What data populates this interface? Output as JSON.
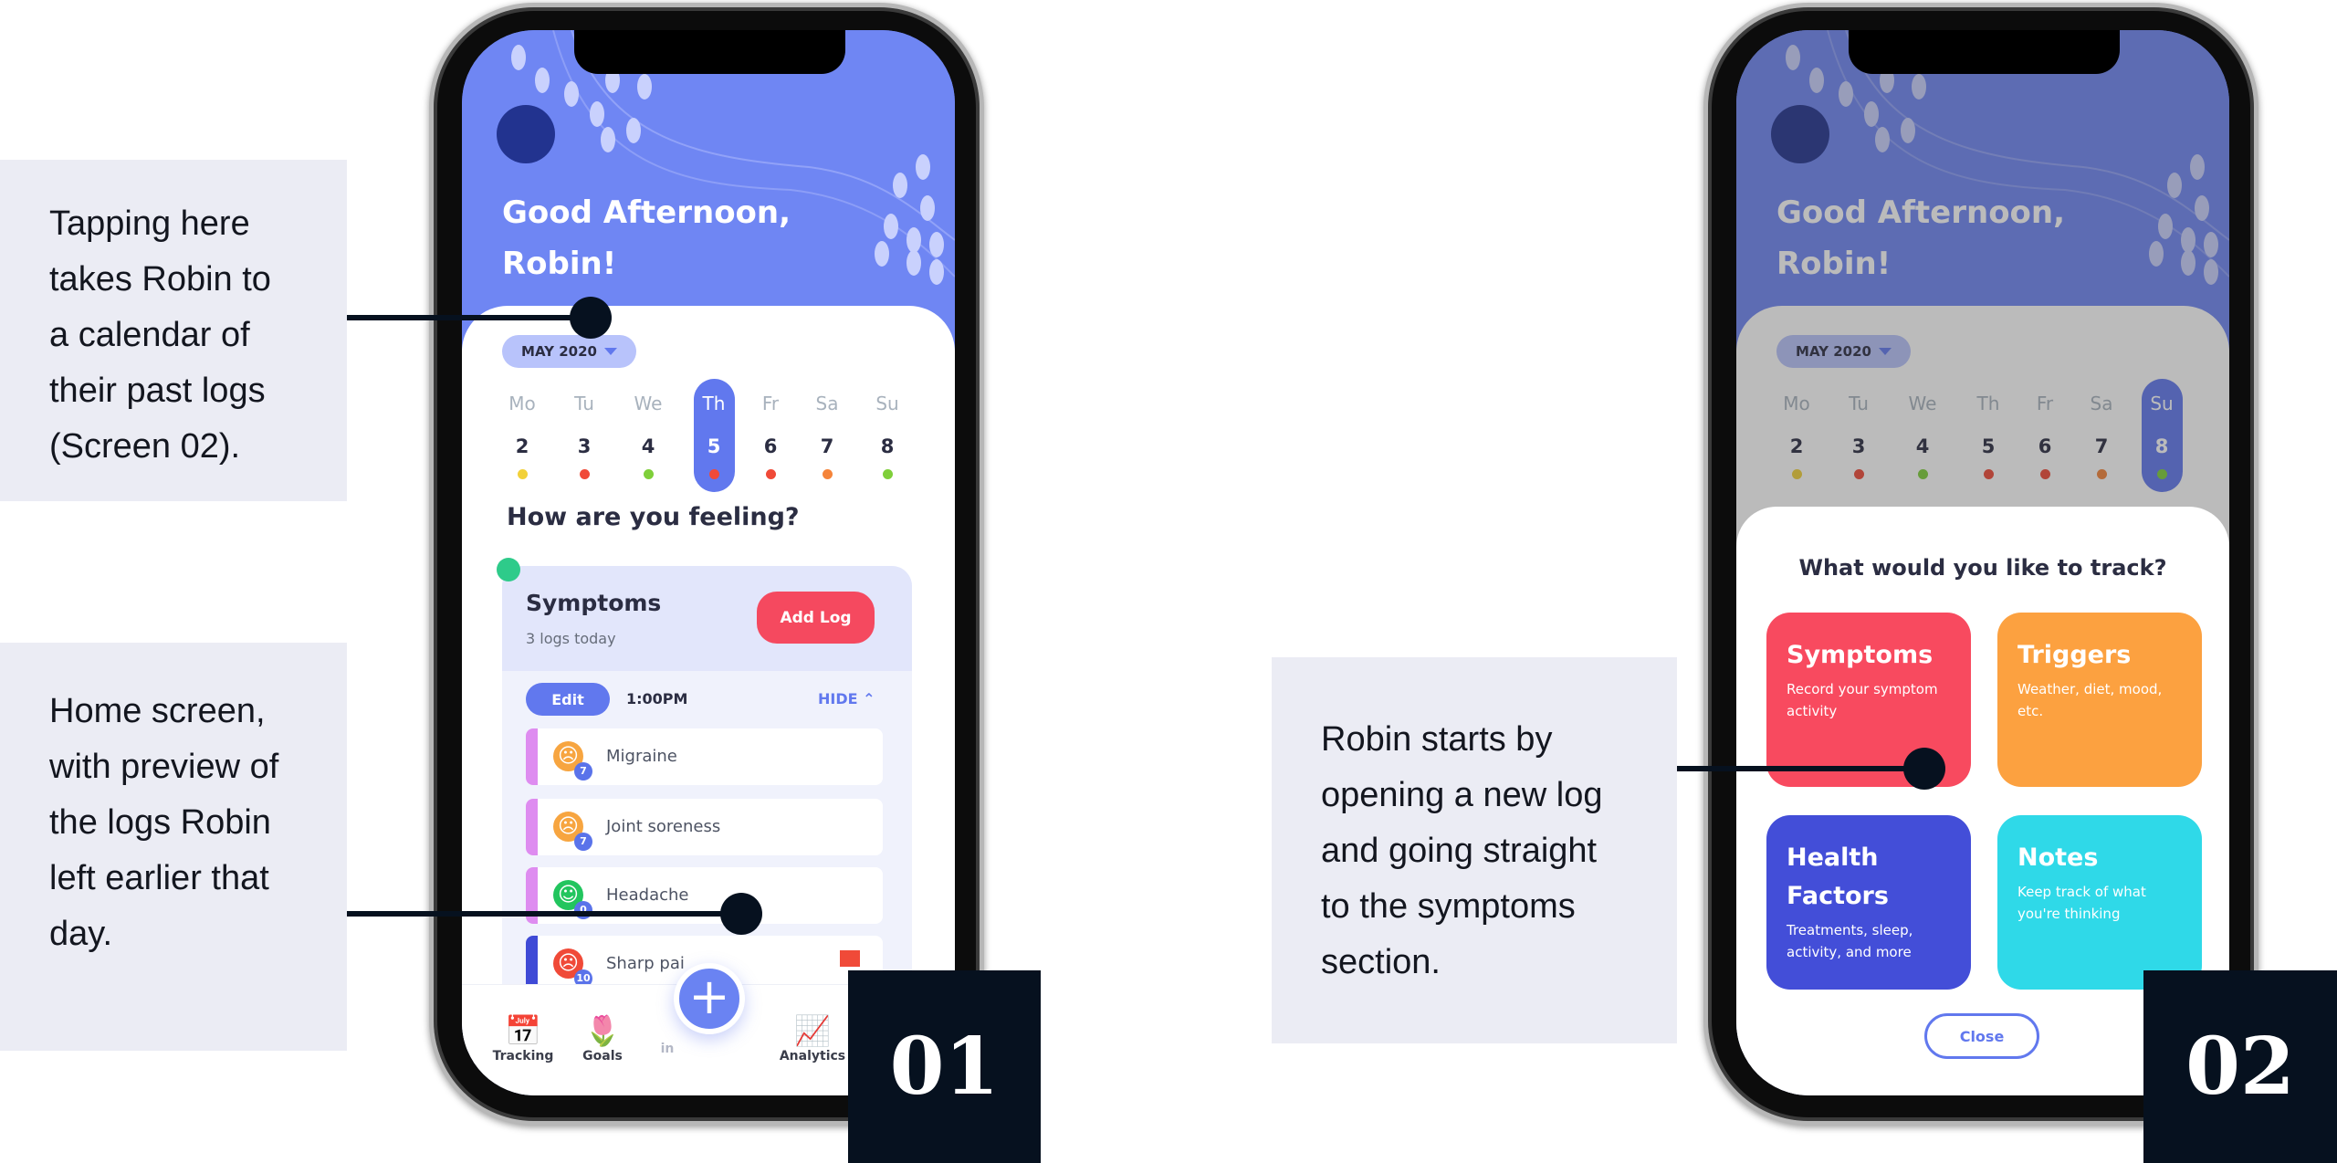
{
  "callouts": {
    "calendar": "Tapping here takes Robin to a calendar of their past logs (Screen 02).",
    "home": "Home screen, with preview of the logs Robin left earlier that day.",
    "newlog": "Robin starts by opening a new log and going straight to the symptoms section."
  },
  "screen_numbers": [
    "01",
    "02"
  ],
  "home": {
    "greeting_line1": "Good Afternoon,",
    "greeting_line2": "Robin!",
    "month": "MAY 2020",
    "days": [
      {
        "label": "Mo",
        "num": "2",
        "color": "#f2d13a"
      },
      {
        "label": "Tu",
        "num": "3",
        "color": "#f04a38"
      },
      {
        "label": "We",
        "num": "4",
        "color": "#7fcf3a"
      },
      {
        "label": "Th",
        "num": "5",
        "color": "#f04a38"
      },
      {
        "label": "Fr",
        "num": "6",
        "color": "#f04a38"
      },
      {
        "label": "Sa",
        "num": "7",
        "color": "#f5843a"
      },
      {
        "label": "Su",
        "num": "8",
        "color": "#7fcf3a"
      }
    ],
    "selected_day_screen1": "Th",
    "selected_day_screen2": "Su",
    "feeling_title": "How are you feeling?",
    "symptoms": {
      "title": "Symptoms",
      "subtitle": "3 logs today",
      "add_log": "Add Log",
      "edit": "Edit",
      "time": "1:00PM",
      "hide": "HIDE",
      "rows": [
        {
          "label": "Migraine",
          "score": "7",
          "mood": "sad",
          "face_color": "#f7a540",
          "bar_color": "#de8cf0"
        },
        {
          "label": "Joint soreness",
          "score": "7",
          "mood": "sad",
          "face_color": "#f7a540",
          "bar_color": "#de8cf0"
        },
        {
          "label": "Headache",
          "score": "0",
          "mood": "happy",
          "face_color": "#22c55e",
          "bar_color": "#de8cf0"
        },
        {
          "label": "Sharp pai",
          "score": "10",
          "mood": "sad",
          "face_color": "#f04a38",
          "bar_color": "#3f4ad6",
          "flagged": true
        }
      ]
    },
    "nav": {
      "tracking": "Tracking",
      "goals": "Goals",
      "partial": "in",
      "analytics": "Analytics"
    }
  },
  "track_sheet": {
    "title": "What would you like to track?",
    "tiles": [
      {
        "title": "Symptoms",
        "desc": "Record your symptom activity",
        "color": "#f84a5f"
      },
      {
        "title": "Triggers",
        "desc": "Weather, diet, mood, etc.",
        "color": "#fca140"
      },
      {
        "title": "Health Factors",
        "desc": "Treatments, sleep, activity, and more",
        "color": "#434ed8"
      },
      {
        "title": "Notes",
        "desc": "Keep track of what you're thinking",
        "color": "#2fd9e8"
      }
    ],
    "close": "Close"
  }
}
